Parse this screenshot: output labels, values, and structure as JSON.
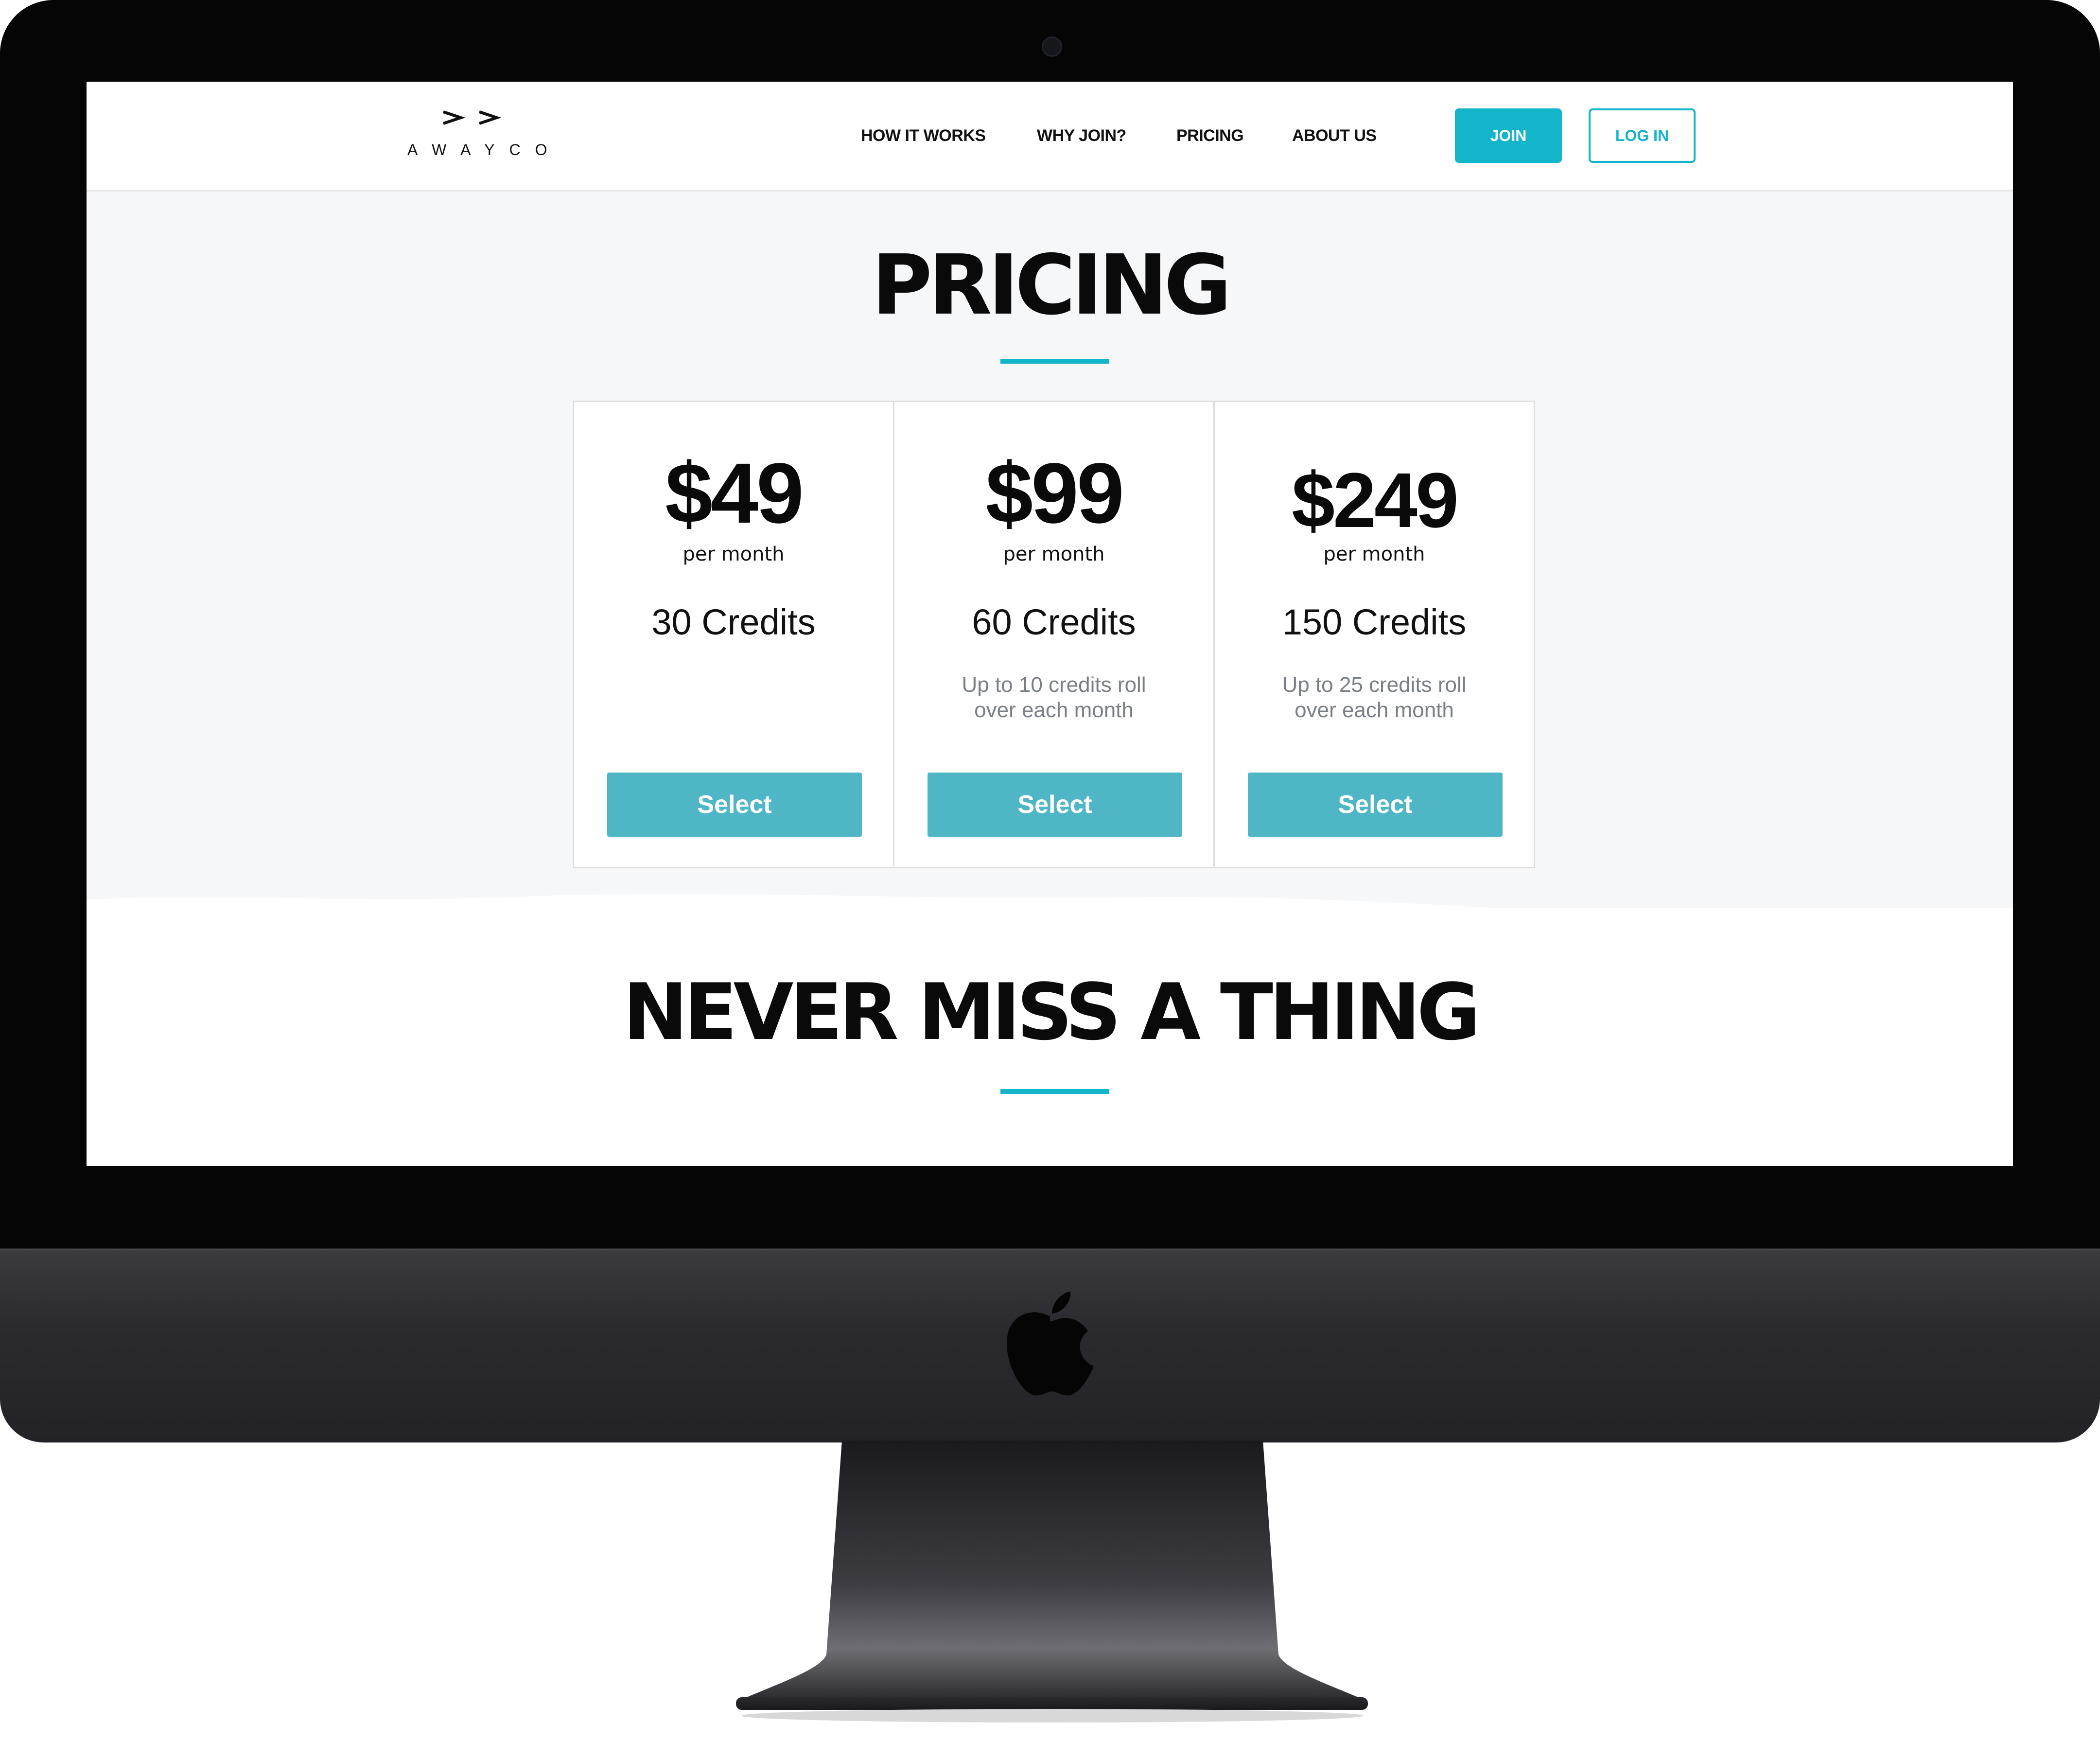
{
  "brand": {
    "logo_text": "AWAYCO",
    "accent_color": "#13b5ca",
    "button_color": "#4fb6c6"
  },
  "nav": {
    "items": [
      {
        "label": "HOW IT WORKS"
      },
      {
        "label": "WHY JOIN?"
      },
      {
        "label": "PRICING"
      },
      {
        "label": "ABOUT US"
      }
    ],
    "join_label": "JOIN",
    "login_label": "LOG IN"
  },
  "pricing": {
    "title": "PRICING",
    "plans": [
      {
        "price": "$49",
        "period": "per month",
        "credits": "30 Credits",
        "note": "",
        "select_label": "Select"
      },
      {
        "price": "$99",
        "period": "per month",
        "credits": "60 Credits",
        "note": "Up to 10 credits roll\nover each month",
        "select_label": "Select"
      },
      {
        "price": "$249",
        "period": "per month",
        "credits": "150 Credits",
        "note": "Up to 25 credits roll\nover each month",
        "select_label": "Select"
      }
    ]
  },
  "next_section": {
    "title": "NEVER MISS A THING"
  },
  "icons": {
    "logo": "awayco-double-arrow-icon",
    "device_logo": "apple-icon"
  }
}
